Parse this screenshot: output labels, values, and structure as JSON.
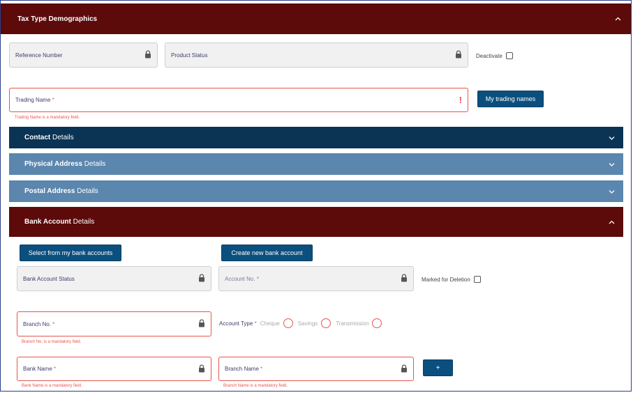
{
  "tax_panel": {
    "title": "Tax Type Demographics"
  },
  "fields": {
    "reference_number": "Reference Number",
    "product_status": "Product Status",
    "trading_name": "Trading Name",
    "trading_name_error": "Trading Name is a mandatory field.",
    "bank_account_status": "Bank Account Status",
    "account_no": "Account No.",
    "branch_no": "Branch No.",
    "branch_no_error": "Branch No. is a mandatory field.",
    "bank_name": "Bank Name",
    "bank_name_error": "Bank Name is a mandatory field.",
    "branch_name": "Branch Name",
    "branch_name_error": "Branch Name is a mandatory field.",
    "required_marker": "*"
  },
  "deactivate": {
    "label": "Deactivate"
  },
  "marked_for_deletion": {
    "label": "Marked for Deletion"
  },
  "buttons": {
    "my_trading_names": "My trading names",
    "select_bank": "Select from my bank accounts",
    "create_bank": "Create new bank account",
    "add": "+"
  },
  "sections": {
    "contact": {
      "bold": "Contact",
      "rest": "Details"
    },
    "physical": {
      "bold": "Physical Address",
      "rest": "Details"
    },
    "postal": {
      "bold": "Postal Address",
      "rest": "Details"
    },
    "bank": {
      "bold": "Bank Account",
      "rest": "Details"
    }
  },
  "account_type": {
    "label": "Account Type",
    "options": [
      "Cheque",
      "Savings",
      "Transmission"
    ]
  },
  "error_indicator": "!",
  "icons": {
    "lock": "lock-icon",
    "chevron_up": "chevron-up-icon",
    "chevron_down": "chevron-down-icon"
  },
  "colors": {
    "maroon": "#5c0a0a",
    "navy": "#0b3354",
    "steel": "#5b86ae",
    "error": "#e8544d",
    "button": "#0b4f7e"
  }
}
